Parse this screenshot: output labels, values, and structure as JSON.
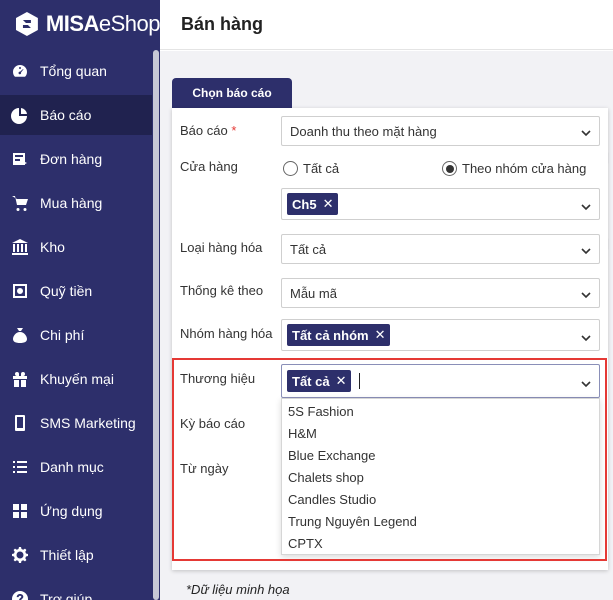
{
  "brand": {
    "name_bold": "MISA",
    "name_thin": "eShop"
  },
  "header": {
    "title": "Bán hàng"
  },
  "sidebar": {
    "items": [
      {
        "label": "Tổng quan",
        "icon": "dashboard-icon"
      },
      {
        "label": "Báo cáo",
        "icon": "pie-chart-icon"
      },
      {
        "label": "Đơn hàng",
        "icon": "order-icon"
      },
      {
        "label": "Mua hàng",
        "icon": "cart-icon"
      },
      {
        "label": "Kho",
        "icon": "warehouse-icon"
      },
      {
        "label": "Quỹ tiền",
        "icon": "safe-icon"
      },
      {
        "label": "Chi phí",
        "icon": "money-bag-icon"
      },
      {
        "label": "Khuyến mại",
        "icon": "gift-icon"
      },
      {
        "label": "SMS Marketing",
        "icon": "phone-icon"
      },
      {
        "label": "Danh mục",
        "icon": "list-icon"
      },
      {
        "label": "Ứng dụng",
        "icon": "apps-icon"
      },
      {
        "label": "Thiết lập",
        "icon": "gear-icon"
      },
      {
        "label": "Trợ giúp",
        "icon": "help-icon"
      }
    ],
    "active_index": 1
  },
  "tab": {
    "label": "Chọn báo cáo"
  },
  "form": {
    "report_label": "Báo cáo",
    "required_mark": "*",
    "report_value": "Doanh thu theo mặt hàng",
    "store_label": "Cửa hàng",
    "store_options": [
      "Tất cả",
      "Theo nhóm cửa hàng"
    ],
    "store_selected": 1,
    "store_group_chip": "Ch5",
    "goods_type_label": "Loại hàng hóa",
    "goods_type_value": "Tất cả",
    "stat_by_label": "Thống kê theo",
    "stat_by_value": "Mẫu mã",
    "goods_group_label": "Nhóm hàng hóa",
    "goods_group_chip": "Tất cả nhóm",
    "brand_label": "Thương hiệu",
    "brand_chip": "Tất cả",
    "period_label": "Kỳ báo cáo",
    "from_date_label": "Từ ngày",
    "chip_remove": "✕"
  },
  "brand_dropdown": {
    "options": [
      "5S Fashion",
      "H&M",
      "Blue Exchange",
      "Chalets shop",
      "Candles Studio",
      "Trung Nguyên Legend",
      "CPTX"
    ]
  },
  "footnote": "*Dữ liệu minh họa",
  "colors": {
    "sidebar": "#2d2f6b",
    "active": "#20224f",
    "highlight": "#e53935"
  }
}
